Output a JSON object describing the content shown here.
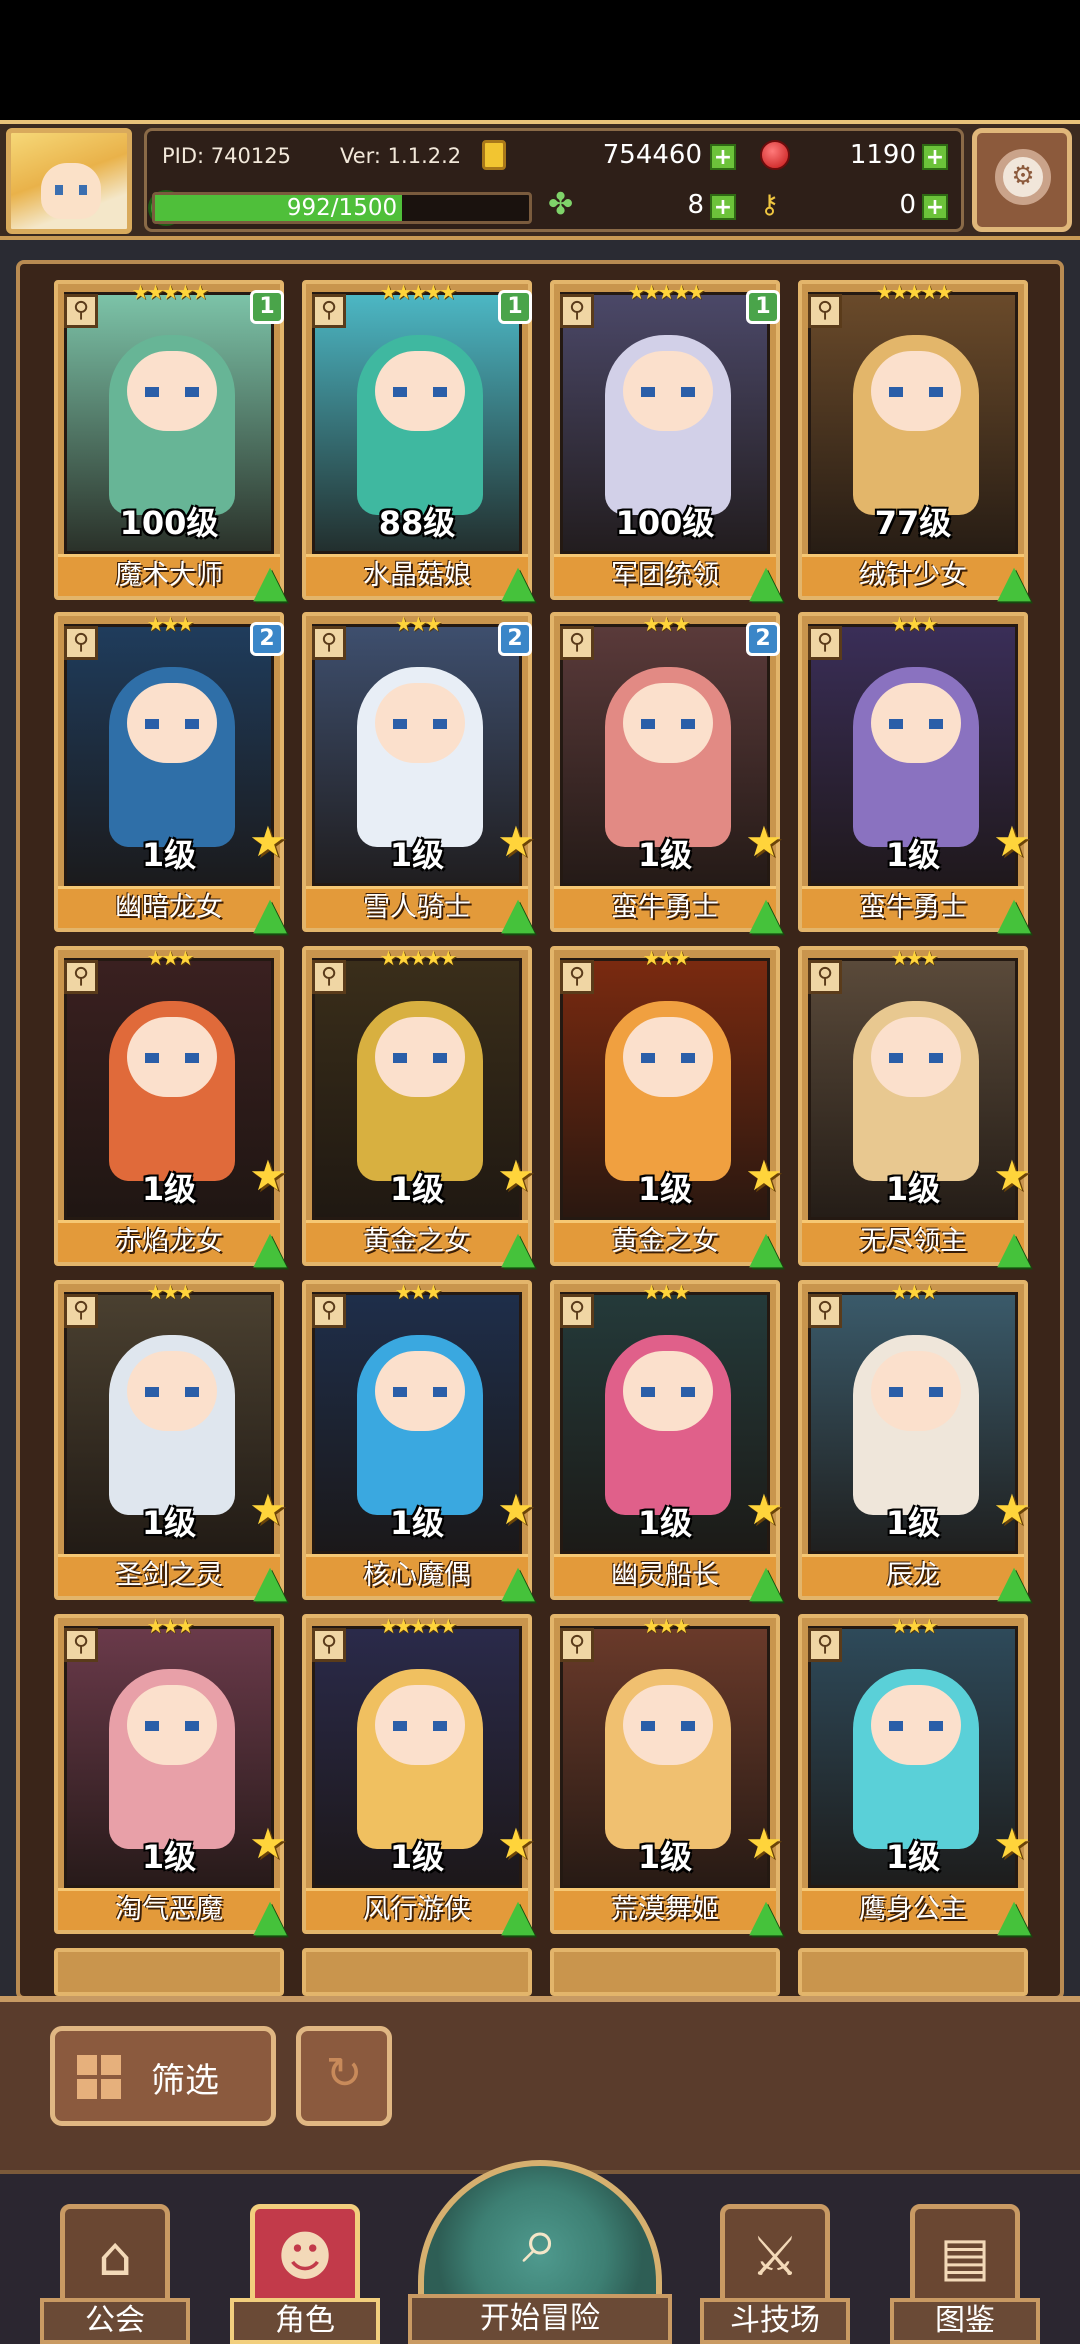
{
  "header": {
    "pid": "PID: 740125",
    "version": "Ver: 1.1.2.2",
    "gold": "754460",
    "gems": "1190",
    "clover": "8",
    "keys": "0",
    "xp_text": "992/1500",
    "xp_progress": 0.661
  },
  "cards": [
    {
      "level": "100级",
      "name": "魔术大师",
      "stars": "★★★★★",
      "badge": "1",
      "badge_color": "#4aa44a",
      "art": "#7cc3a8",
      "hair": "#67b596"
    },
    {
      "level": "88级",
      "name": "水晶菇娘",
      "stars": "★★★★★",
      "badge": "1",
      "badge_color": "#4aa44a",
      "art": "#4cb7c4",
      "hair": "#3fb8a0"
    },
    {
      "level": "100级",
      "name": "军团统领",
      "stars": "★★★★★",
      "badge": "1",
      "badge_color": "#4aa44a",
      "art": "#4b4868",
      "hair": "#d2d0e8"
    },
    {
      "level": "77级",
      "name": "绒针少女",
      "stars": "★★★★★",
      "badge": "",
      "badge_color": "",
      "art": "#6a4a2a",
      "hair": "#e3b66a"
    },
    {
      "level": "1级",
      "name": "幽暗龙女",
      "stars": "★★★",
      "badge": "2",
      "badge_color": "#3a86c8",
      "art": "#1f3c5c",
      "hair": "#2f6fa8"
    },
    {
      "level": "1级",
      "name": "雪人骑士",
      "stars": "★★★",
      "badge": "2",
      "badge_color": "#3a86c8",
      "art": "#3e4f6e",
      "hair": "#e8eef6"
    },
    {
      "level": "1级",
      "name": "蛮牛勇士",
      "stars": "★★★",
      "badge": "2",
      "badge_color": "#3a86c8",
      "art": "#5a3a3a",
      "hair": "#e28a84"
    },
    {
      "level": "1级",
      "name": "蛮牛勇士",
      "stars": "★★★",
      "badge": "",
      "badge_color": "",
      "art": "#3a2e58",
      "hair": "#8a72c0"
    },
    {
      "level": "1级",
      "name": "赤焰龙女",
      "stars": "★★★",
      "badge": "",
      "badge_color": "",
      "art": "#3a2020",
      "hair": "#e06a3a"
    },
    {
      "level": "1级",
      "name": "黄金之女",
      "stars": "★★★★★",
      "badge": "",
      "badge_color": "",
      "art": "#3a2e1a",
      "hair": "#d8b040"
    },
    {
      "level": "1级",
      "name": "黄金之女",
      "stars": "★★★",
      "badge": "",
      "badge_color": "",
      "art": "#7a2a10",
      "hair": "#f0a040"
    },
    {
      "level": "1级",
      "name": "无尽领主",
      "stars": "★★★",
      "badge": "",
      "badge_color": "",
      "art": "#5a4a3a",
      "hair": "#e8c890"
    },
    {
      "level": "1级",
      "name": "圣剑之灵",
      "stars": "★★★",
      "badge": "",
      "badge_color": "",
      "art": "#4a4030",
      "hair": "#dfe6ee"
    },
    {
      "level": "1级",
      "name": "核心魔偶",
      "stars": "★★★",
      "badge": "",
      "badge_color": "",
      "art": "#1e2e4a",
      "hair": "#3aa8e0"
    },
    {
      "level": "1级",
      "name": "幽灵船长",
      "stars": "★★★",
      "badge": "",
      "badge_color": "",
      "art": "#243a3a",
      "hair": "#e0608a"
    },
    {
      "level": "1级",
      "name": "辰龙",
      "stars": "★★★",
      "badge": "",
      "badge_color": "",
      "art": "#3a5a6a",
      "hair": "#efe6da"
    },
    {
      "level": "1级",
      "name": "淘气恶魔",
      "stars": "★★★",
      "badge": "",
      "badge_color": "",
      "art": "#6a3a4a",
      "hair": "#e8a0a8"
    },
    {
      "level": "1级",
      "name": "风行游侠",
      "stars": "★★★★★",
      "badge": "",
      "badge_color": "",
      "art": "#2a2a4a",
      "hair": "#f0c060"
    },
    {
      "level": "1级",
      "name": "荒漠舞姬",
      "stars": "★★★",
      "badge": "",
      "badge_color": "",
      "art": "#6a3a2a",
      "hair": "#f0c070"
    },
    {
      "level": "1级",
      "name": "鹰身公主",
      "stars": "★★★",
      "badge": "",
      "badge_color": "",
      "art": "#2e4a5a",
      "hair": "#5ad0d8"
    }
  ],
  "controls": {
    "filter_label": "筛选"
  },
  "nav": {
    "guild": "公会",
    "character": "角色",
    "adventure": "开始冒险",
    "arena": "斗技场",
    "codex": "图鉴"
  }
}
